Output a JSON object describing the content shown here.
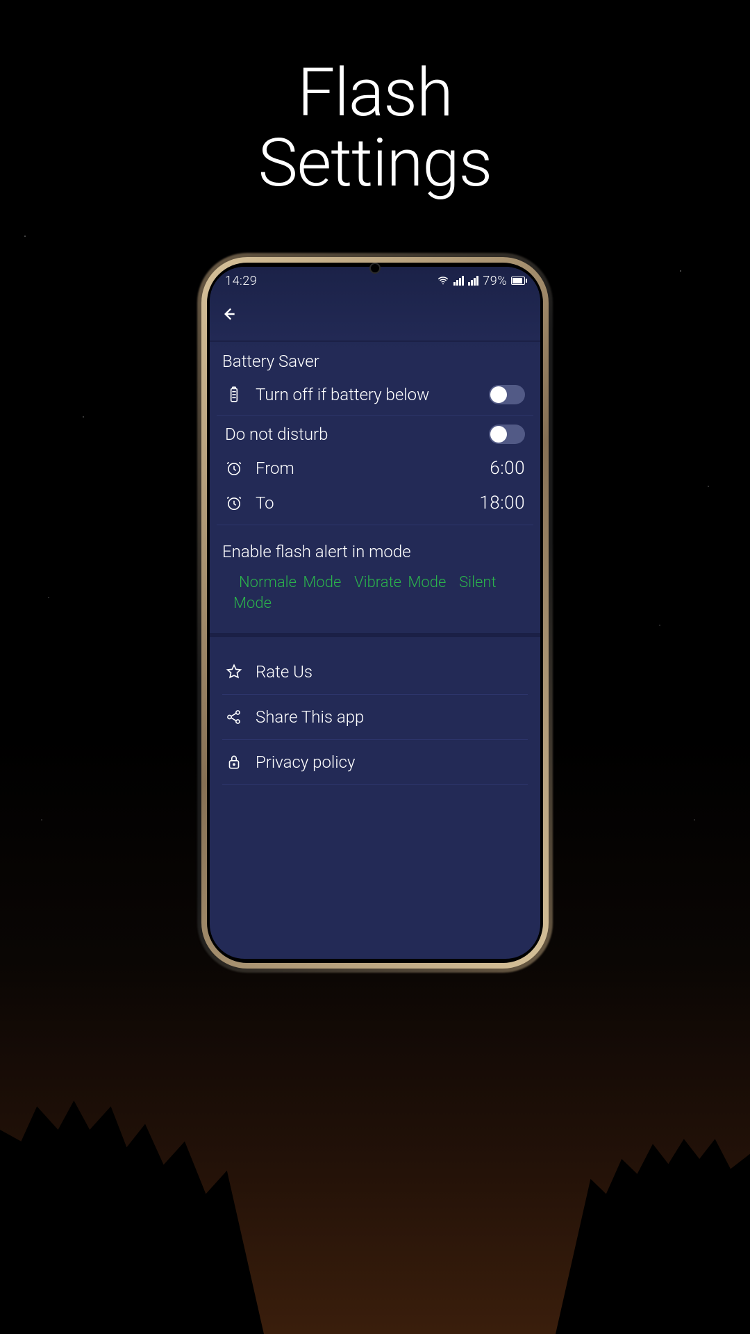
{
  "promo": {
    "title_line1": "Flash",
    "title_line2": "Settings"
  },
  "statusbar": {
    "time": "14:29",
    "battery_text": "79%",
    "battery_pct": 79
  },
  "battery_saver": {
    "header": "Battery Saver",
    "toggle_label": "Turn off if battery below",
    "toggle_on": false
  },
  "dnd": {
    "header": "Do not disturb",
    "toggle_on": false,
    "from_label": "From",
    "from_value": "6:00",
    "to_label": "To",
    "to_value": "18:00"
  },
  "modes": {
    "header": "Enable flash alert in mode",
    "normal": "Normale Mode",
    "vibrate": "Vibrate Mode",
    "silent": "Silent Mode"
  },
  "links": {
    "rate": "Rate Us",
    "share": "Share This app",
    "privacy": "Privacy policy"
  }
}
